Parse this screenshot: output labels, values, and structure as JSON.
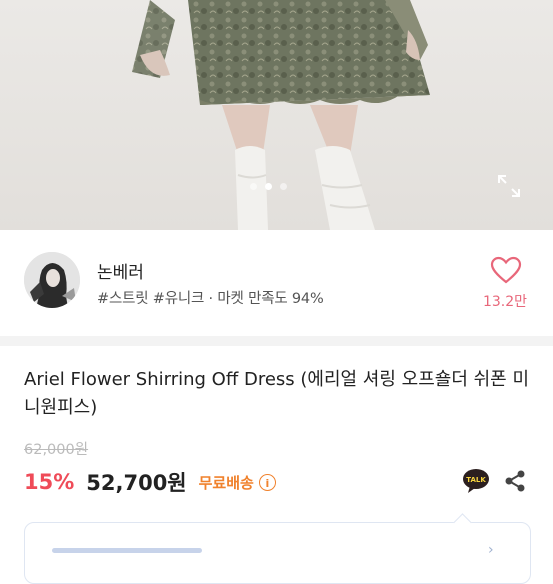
{
  "carousel": {
    "slide_count": 3,
    "active_index": 1,
    "expand_icon": "expand-icon"
  },
  "seller": {
    "name": "논베러",
    "tags": "#스트릿 #유니크 · 마켓 만족도 94%",
    "likes": "13.2만",
    "heart_color": "#e8677a"
  },
  "product": {
    "title": "Ariel Flower Shirring Off Dress (에리얼 셔링 오프숄더 쉬폰 미니원피스)",
    "original_price": "62,000원",
    "discount": "15%",
    "price": "52,700원",
    "shipping": "무료배송",
    "info_icon_text": "i",
    "discount_color": "#ef4b58",
    "shipping_color": "#f0822d"
  },
  "actions": {
    "talk_label": "TALK",
    "share_icon": "share-icon"
  }
}
